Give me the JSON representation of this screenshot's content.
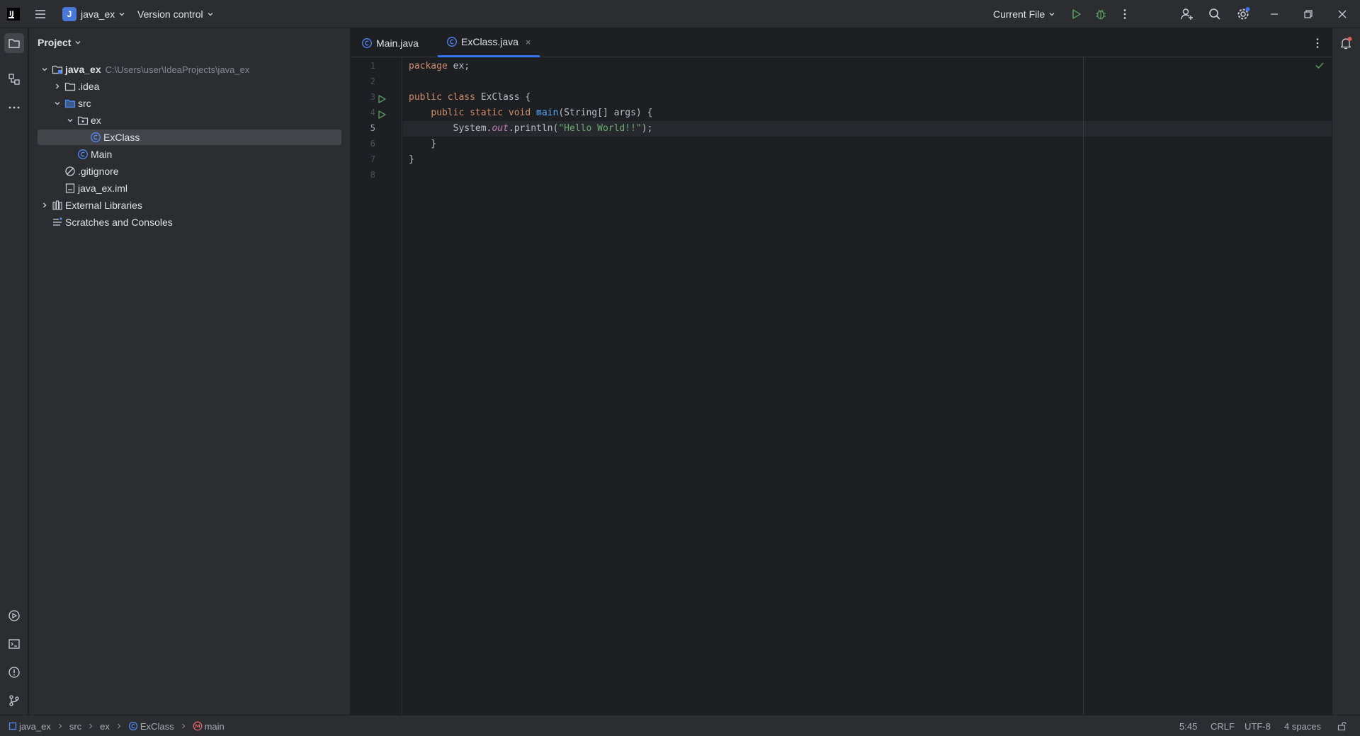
{
  "titlebar": {
    "project_badge": "J",
    "project_name": "java_ex",
    "vcs_label": "Version control",
    "run_config": "Current File",
    "icons": [
      "app-logo-icon",
      "hamburger-menu-icon",
      "run-icon",
      "debug-icon",
      "more-vertical-icon",
      "add-user-icon",
      "search-icon",
      "settings-icon",
      "minimize-icon",
      "restore-icon",
      "close-icon"
    ]
  },
  "project_panel": {
    "title": "Project",
    "tree": [
      {
        "label": "java_ex",
        "hint": "C:\\Users\\user\\IdeaProjects\\java_ex",
        "icon": "module-folder-icon"
      },
      {
        "label": ".idea",
        "icon": "folder-icon"
      },
      {
        "label": "src",
        "icon": "source-folder-icon"
      },
      {
        "label": "ex",
        "icon": "package-icon"
      },
      {
        "label": "ExClass",
        "icon": "java-class-icon"
      },
      {
        "label": "Main",
        "icon": "java-class-icon"
      },
      {
        "label": ".gitignore",
        "icon": "ignore-file-icon"
      },
      {
        "label": "java_ex.iml",
        "icon": "iml-file-icon"
      },
      {
        "label": "External Libraries",
        "icon": "libraries-icon"
      },
      {
        "label": "Scratches and Consoles",
        "icon": "scratches-icon"
      }
    ]
  },
  "editor": {
    "tabs": [
      {
        "label": "Main.java"
      },
      {
        "label": "ExClass.java",
        "close": "×"
      }
    ],
    "line_numbers": [
      "1",
      "2",
      "3",
      "4",
      "5",
      "6",
      "7",
      "8"
    ],
    "current_line": 5,
    "code": {
      "l1_kw": "package",
      "l1_rest": " ex;",
      "l3_kw": "public class",
      "l3_rest": " ExClass {",
      "l4_indent": "    ",
      "l4_kw": "public static void",
      "l4_sp": " ",
      "l4_fn": "main",
      "l4_rest": "(String[] args) {",
      "l5_a": "        System.",
      "l5_it": "out",
      "l5_b": ".println(",
      "l5_st": "\"Hello World!!\"",
      "l5_c": ");",
      "l6": "    }",
      "l7": "}"
    }
  },
  "statusbar": {
    "breadcrumbs": [
      "java_ex",
      "src",
      "ex",
      "ExClass",
      "main"
    ],
    "position": "5:45",
    "line_sep": "CRLF",
    "encoding": "UTF-8",
    "indent": "4 spaces"
  },
  "colors": {
    "accent": "#3574f0",
    "run_green": "#57965c",
    "keyword": "#cf8e6d",
    "function": "#56a8f5",
    "string": "#6aab73",
    "static_field": "#c77dbb",
    "class_icon": "#548af7"
  }
}
